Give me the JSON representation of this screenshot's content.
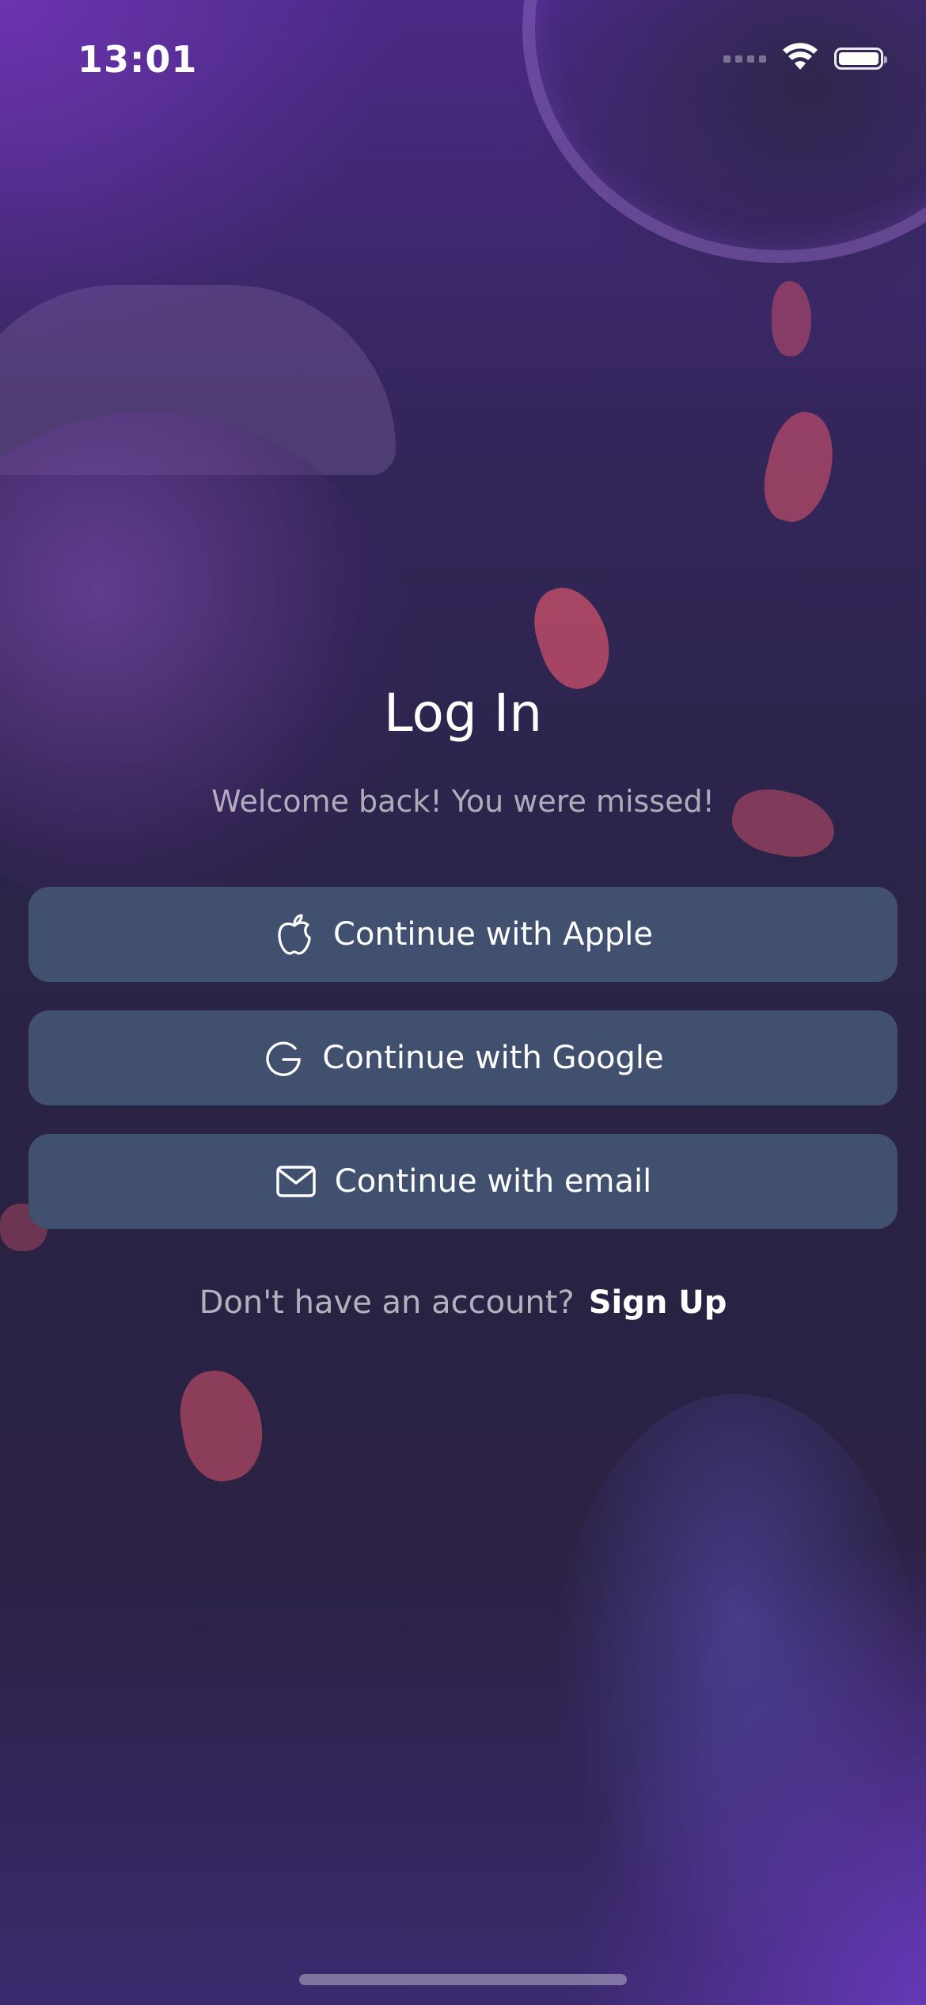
{
  "status_bar": {
    "time": "13:01",
    "icons": [
      "cellular-signal-icon",
      "wifi-icon",
      "battery-icon"
    ]
  },
  "login": {
    "title": "Log In",
    "subtitle": "Welcome back! You were missed!",
    "buttons": [
      {
        "label": "Continue with Apple",
        "icon": "apple-icon"
      },
      {
        "label": "Continue with Google",
        "icon": "google-icon"
      },
      {
        "label": "Continue with email",
        "icon": "mail-icon"
      }
    ],
    "signup_prompt": "Don't have an account?",
    "signup_link": "Sign Up"
  },
  "colors": {
    "button_background": "#42506f",
    "background_purple": "#4a2a86",
    "background_dark": "#2a2243",
    "text_primary": "#ffffff"
  }
}
